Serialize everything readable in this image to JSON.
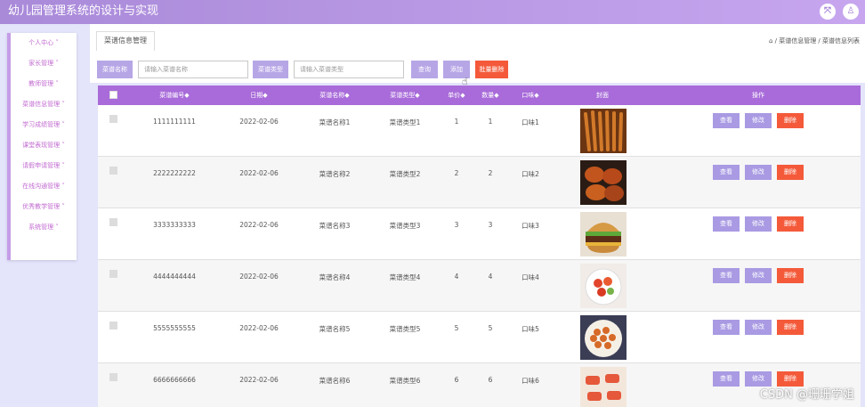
{
  "app": {
    "title": "幼儿园管理系统的设计与实现",
    "watermark": "CSDN @珊珊学姐"
  },
  "topbar_icons": [
    "expand-icon",
    "user-icon"
  ],
  "sidebar": {
    "items": [
      {
        "label": "个人中心 ˅"
      },
      {
        "label": "家长管理 ˅"
      },
      {
        "label": "教师管理 ˅"
      },
      {
        "label": "菜谱信息管理 ˅"
      },
      {
        "label": "学习成绩管理 ˅"
      },
      {
        "label": "课堂表现管理 ˅"
      },
      {
        "label": "请假申请管理 ˅"
      },
      {
        "label": "在线沟通管理 ˅"
      },
      {
        "label": "优秀教学管理 ˅"
      },
      {
        "label": "系统管理 ˅"
      }
    ]
  },
  "tabs": [
    {
      "label": "菜谱信息管理"
    }
  ],
  "breadcrumb": "⌂ / 菜谱信息管理 / 菜谱信息列表",
  "search": {
    "name_label": "菜谱名称",
    "name_placeholder": "请输入菜谱名称",
    "type_label": "菜谱类型",
    "type_placeholder": "请输入菜谱类型",
    "query_label": "查询",
    "add_label": "添加",
    "batch_delete_label": "批量删除"
  },
  "table": {
    "columns": [
      "菜谱编号◆",
      "日期◆",
      "菜谱名称◆",
      "菜谱类型◆",
      "单价◆",
      "数量◆",
      "口味◆",
      "封面",
      "操作"
    ],
    "actions": {
      "view": "查看",
      "edit": "修改",
      "delete": "删除"
    },
    "rows": [
      {
        "id": "1111111111",
        "date": "2022-02-06",
        "name": "菜谱名称1",
        "type": "菜谱类型1",
        "price": "1",
        "qty": "1",
        "taste": "口味1",
        "cover": "skewers"
      },
      {
        "id": "2222222222",
        "date": "2022-02-06",
        "name": "菜谱名称2",
        "type": "菜谱类型2",
        "price": "2",
        "qty": "2",
        "taste": "口味2",
        "cover": "crabs"
      },
      {
        "id": "3333333333",
        "date": "2022-02-06",
        "name": "菜谱名称3",
        "type": "菜谱类型3",
        "price": "3",
        "qty": "3",
        "taste": "口味3",
        "cover": "burger"
      },
      {
        "id": "4444444444",
        "date": "2022-02-06",
        "name": "菜谱名称4",
        "type": "菜谱类型4",
        "price": "4",
        "qty": "4",
        "taste": "口味4",
        "cover": "salad"
      },
      {
        "id": "5555555555",
        "date": "2022-02-06",
        "name": "菜谱名称5",
        "type": "菜谱类型5",
        "price": "5",
        "qty": "5",
        "taste": "口味5",
        "cover": "plate"
      },
      {
        "id": "6666666666",
        "date": "2022-02-06",
        "name": "菜谱名称6",
        "type": "菜谱类型6",
        "price": "6",
        "qty": "6",
        "taste": "口味6",
        "cover": "sushi"
      }
    ]
  },
  "colors": {
    "accent": "#a86bd9",
    "button": "#b7a6e6",
    "danger": "#f45a3a"
  }
}
